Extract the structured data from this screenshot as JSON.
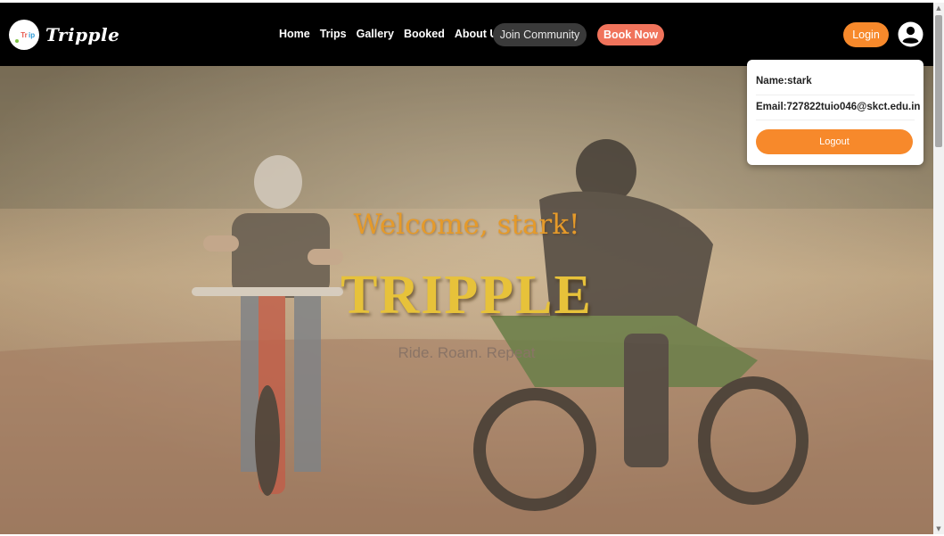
{
  "brand": {
    "logo_text": "Tripple",
    "badge_text": "Tripple"
  },
  "nav": {
    "links": [
      "Home",
      "Trips",
      "Gallery",
      "Booked",
      "About Us"
    ],
    "join_label": "Join Community",
    "book_label": "Book Now",
    "login_label": "Login"
  },
  "hero": {
    "welcome": "Welcome, stark!",
    "title": "TRIPPLE",
    "tagline": "Ride. Roam. Repeat"
  },
  "user_menu": {
    "name": "Name:stark",
    "email": "Email:727822tuio046@skct.edu.in",
    "logout_label": "Logout"
  },
  "icons": {
    "user": "user-circle-icon",
    "scroll_up": "triangle-up-icon",
    "scroll_down": "triangle-down-icon"
  },
  "colors": {
    "navbar_bg": "#000000",
    "accent_orange": "#f7892b",
    "book_now": "#f0735b",
    "welcome_text": "#e59a2a",
    "brand_text": "#e7c23a"
  }
}
